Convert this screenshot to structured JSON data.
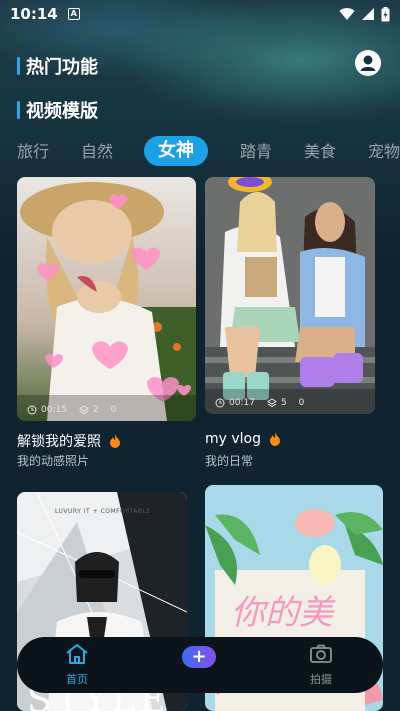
{
  "status": {
    "time": "10:14",
    "notif_letter": "A"
  },
  "header": {
    "hot_features": "热门功能",
    "video_templates": "视频模版"
  },
  "tabs": [
    {
      "label": "旅行"
    },
    {
      "label": "自然"
    },
    {
      "label": "女神",
      "active": true
    },
    {
      "label": "踏青"
    },
    {
      "label": "美食"
    },
    {
      "label": "宠物"
    }
  ],
  "cards": [
    {
      "duration": "00:15",
      "layers": "2",
      "count": "0",
      "title": "解锁我的爱照",
      "subtitle": "我的动感照片"
    },
    {
      "duration": "00:17",
      "layers": "5",
      "count": "0",
      "title": "my vlog",
      "subtitle": "我的日常"
    },
    {
      "overlay_text": "LUVURY IT + COMFORTABLE",
      "big_text": "STYLE"
    },
    {
      "overlay_text": "你的美"
    }
  ],
  "bottom_nav": {
    "home": "首页",
    "add_symbol": "+",
    "shoot": "拍摄"
  },
  "colors": {
    "accent": "#1ca0e8",
    "background": "#0f2430",
    "fire": "#ff8a1c"
  }
}
